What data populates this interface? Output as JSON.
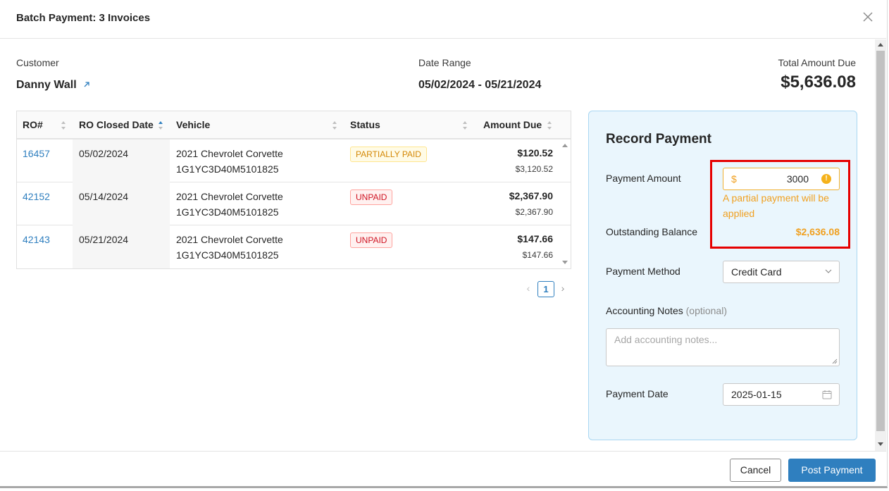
{
  "modal": {
    "title": "Batch Payment: 3 Invoices"
  },
  "summary": {
    "customer_label": "Customer",
    "customer_name": "Danny Wall",
    "date_range_label": "Date Range",
    "date_range": "05/02/2024 - 05/21/2024",
    "total_label": "Total Amount Due",
    "total": "$5,636.08"
  },
  "table": {
    "headers": [
      "RO#",
      "RO Closed Date",
      "Vehicle",
      "Status",
      "Amount Due"
    ],
    "rows": [
      {
        "ro": "16457",
        "closed": "05/02/2024",
        "vehicle": "2021 Chevrolet Corvette",
        "vin": "1G1YC3D40M5101825",
        "status": "PARTIALLY PAID",
        "amount_due": "$120.52",
        "amount_total": "$3,120.52"
      },
      {
        "ro": "42152",
        "closed": "05/14/2024",
        "vehicle": "2021 Chevrolet Corvette",
        "vin": "1G1YC3D40M5101825",
        "status": "UNPAID",
        "amount_due": "$2,367.90",
        "amount_total": "$2,367.90"
      },
      {
        "ro": "42143",
        "closed": "05/21/2024",
        "vehicle": "2021 Chevrolet Corvette",
        "vin": "1G1YC3D40M5101825",
        "status": "UNPAID",
        "amount_due": "$147.66",
        "amount_total": "$147.66"
      }
    ]
  },
  "pagination": {
    "current": "1",
    "prev": "‹",
    "next": "›"
  },
  "payment": {
    "title": "Record Payment",
    "amount_label": "Payment Amount",
    "currency_symbol": "$",
    "amount_value": "3000",
    "warning_icon": "!",
    "warning_text": "A partial payment will be applied",
    "outstanding_label": "Outstanding Balance",
    "outstanding_value": "$2,636.08",
    "method_label": "Payment Method",
    "method_value": "Credit Card",
    "notes_label": "Accounting Notes",
    "notes_optional": "(optional)",
    "notes_placeholder": "Add accounting notes...",
    "date_label": "Payment Date",
    "date_value": "2025-01-15"
  },
  "footer": {
    "cancel_label": "Cancel",
    "post_label": "Post Payment"
  },
  "colors": {
    "link": "#2f7fbf",
    "primary_button": "#2f7fbf",
    "warning": "#f0a020",
    "highlight_border": "#e60000",
    "panel_bg": "#eaf6fd",
    "partially_paid_text": "#d48806",
    "unpaid_text": "#cf1322"
  }
}
